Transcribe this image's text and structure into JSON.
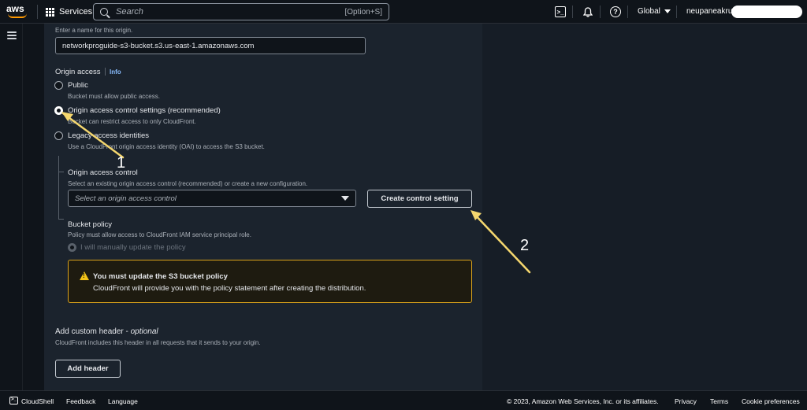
{
  "topnav": {
    "logo_text": "aws",
    "services_label": "Services",
    "search_placeholder": "Search",
    "search_shortcut": "[Option+S]",
    "region_label": "Global",
    "account_label": "neupaneakrur @"
  },
  "form": {
    "origin_name_description": "Enter a name for this origin.",
    "origin_name_value": "networkproguide-s3-bucket.s3.us-east-1.amazonaws.com",
    "origin_access_label": "Origin access",
    "info_link": "Info",
    "options": [
      {
        "label": "Public",
        "description": "Bucket must allow public access.",
        "checked": false
      },
      {
        "label": "Origin access control settings (recommended)",
        "description": "Bucket can restrict access to only CloudFront.",
        "checked": true
      },
      {
        "label": "Legacy access identities",
        "description": "Use a CloudFront origin access identity (OAI) to access the S3 bucket.",
        "checked": false
      }
    ],
    "oac_label": "Origin access control",
    "oac_description": "Select an existing origin access control (recommended) or create a new configuration.",
    "oac_select_placeholder": "Select an origin access control",
    "create_button": "Create control setting",
    "bucket_policy_label": "Bucket policy",
    "bucket_policy_description": "Policy must allow access to CloudFront IAM service principal role.",
    "bucket_policy_option": "I will manually update the policy",
    "alert_title": "You must update the S3 bucket policy",
    "alert_body": "CloudFront will provide you with the policy statement after creating the distribution.",
    "custom_header_label": "Add custom header - ",
    "custom_header_optional": "optional",
    "custom_header_description": "CloudFront includes this header in all requests that it sends to your origin.",
    "add_header_button": "Add header"
  },
  "footer": {
    "cloudshell": "CloudShell",
    "feedback": "Feedback",
    "language": "Language",
    "copyright": "© 2023, Amazon Web Services, Inc. or its affiliates.",
    "privacy": "Privacy",
    "terms": "Terms",
    "cookie": "Cookie preferences"
  },
  "annotations": {
    "step1": "1",
    "step2": "2",
    "arrow_color": "#f5d76e"
  },
  "colors": {
    "accent_link": "#89bdff",
    "warning": "#d9a21b",
    "aws_orange": "#ff9900"
  }
}
